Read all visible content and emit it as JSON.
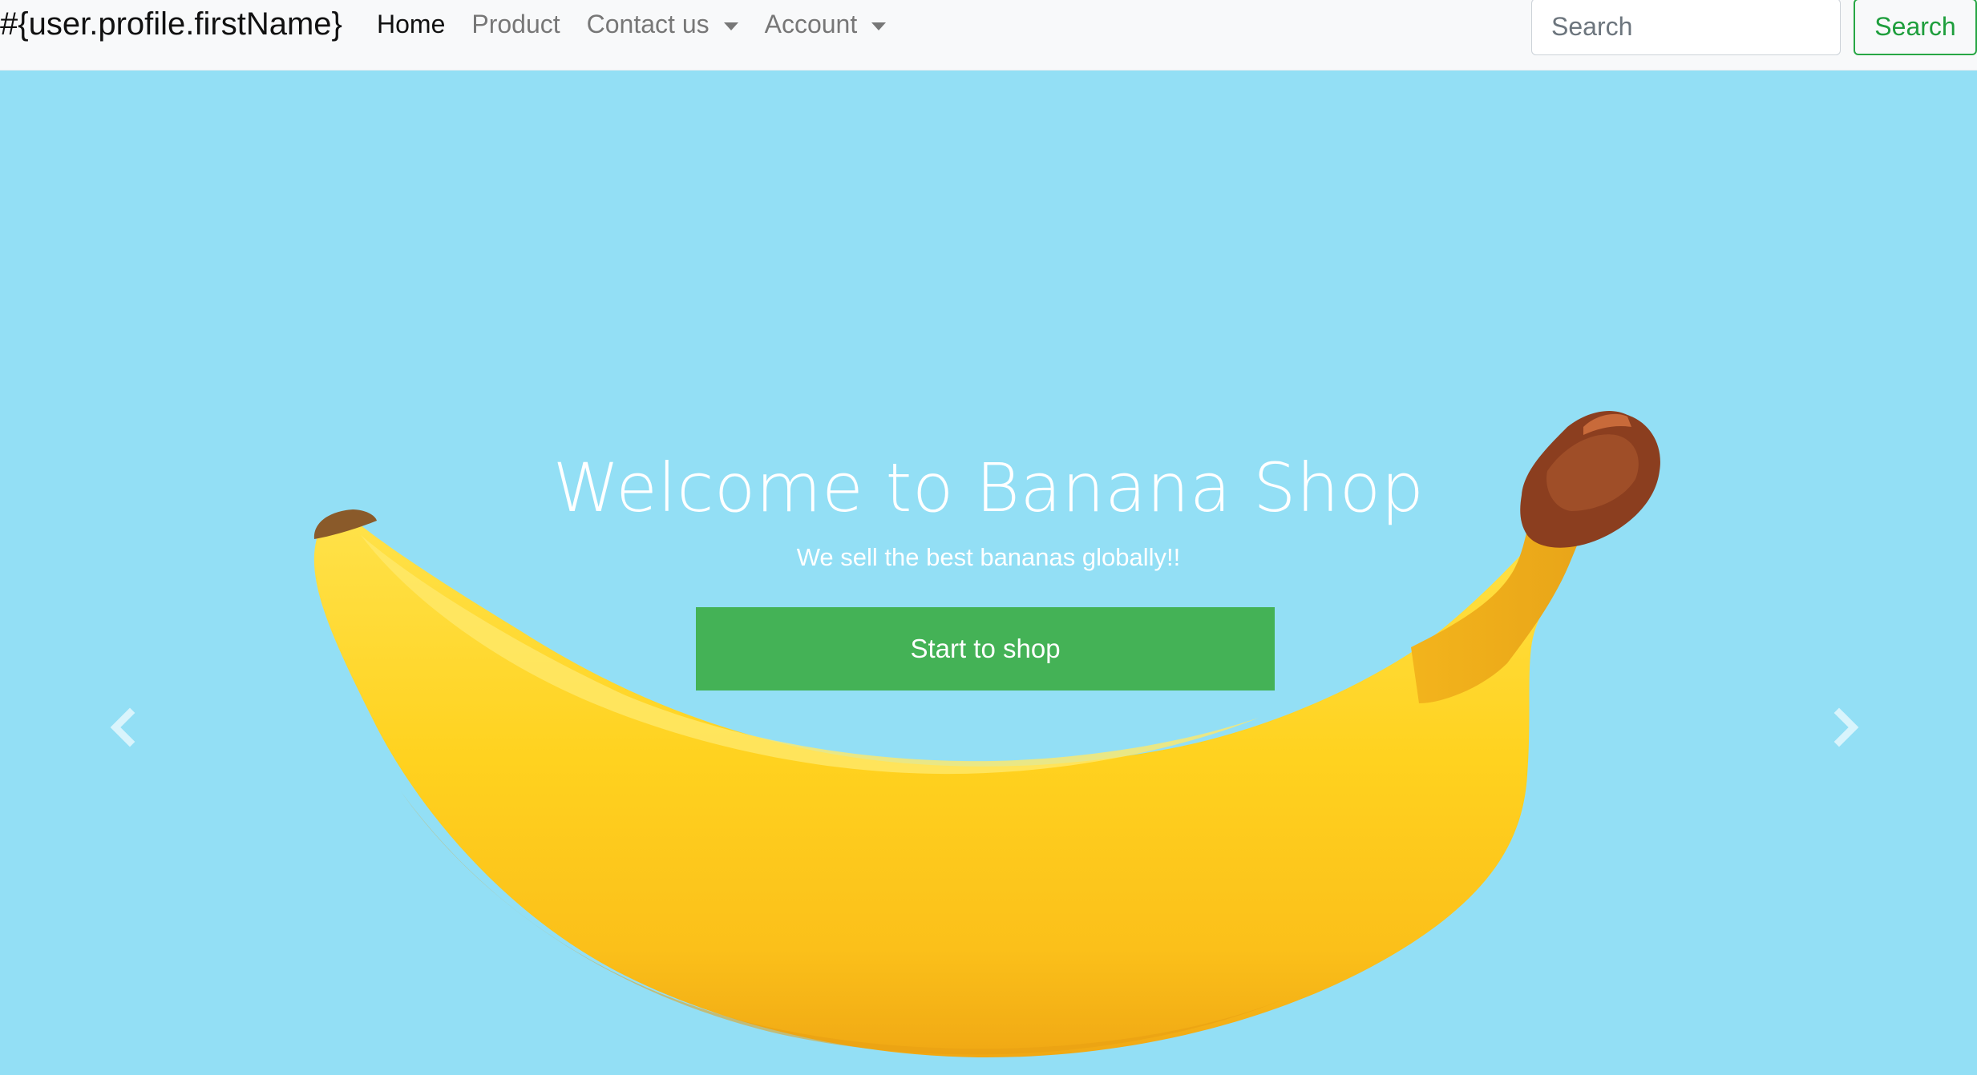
{
  "navbar": {
    "brand": "#{user.profile.firstName}",
    "links": [
      {
        "label": "Home",
        "active": true,
        "dropdown": false
      },
      {
        "label": "Product",
        "active": false,
        "dropdown": false
      },
      {
        "label": "Contact us",
        "active": false,
        "dropdown": true
      },
      {
        "label": "Account",
        "active": false,
        "dropdown": true
      }
    ],
    "search": {
      "placeholder": "Search",
      "button_label": "Search"
    }
  },
  "hero": {
    "title": "Welcome to Banana Shop",
    "subtitle": "We sell the best bananas globally!!",
    "cta_label": "Start to shop",
    "background_color": "#93dff5",
    "cta_color": "#44b256",
    "image": "banana-image"
  },
  "carousel": {
    "prev_icon": "chevron-left-icon",
    "next_icon": "chevron-right-icon"
  }
}
